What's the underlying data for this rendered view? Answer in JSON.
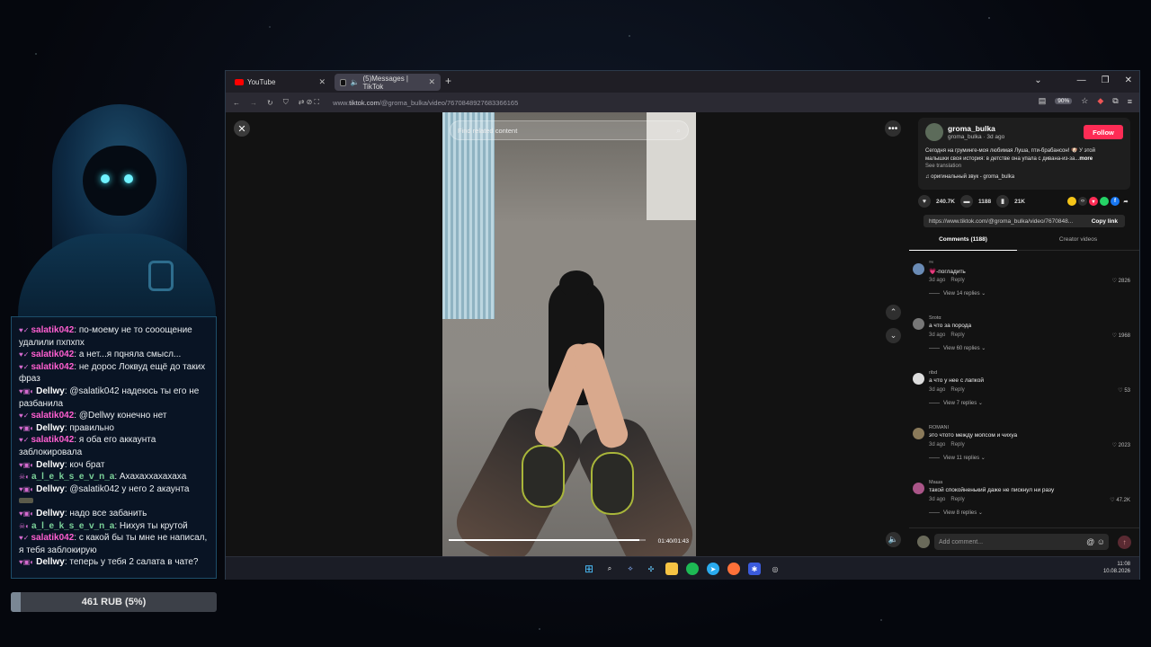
{
  "chat": {
    "messages": [
      {
        "badges": "♥✓",
        "user": "salatik042",
        "color": "pink",
        "text": "по-моему не то сооощение удалили пхпхпх"
      },
      {
        "badges": "♥✓",
        "user": "salatik042",
        "color": "pink",
        "text": "а нет...я пqняла смысл..."
      },
      {
        "badges": "♥✓",
        "user": "salatik042",
        "color": "pink",
        "text": "не дорос Локвуд ещё до таких фраз"
      },
      {
        "badges": "♥▣◐",
        "user": "Dellwy",
        "color": "white",
        "text": "@salatik042 надеюсь ты его не разбанила"
      },
      {
        "badges": "♥✓",
        "user": "salatik042",
        "color": "pink",
        "text": "@Dellwy конечно нет"
      },
      {
        "badges": "♥▣◐",
        "user": "Dellwy",
        "color": "white",
        "text": "правильно"
      },
      {
        "badges": "♥✓",
        "user": "salatik042",
        "color": "pink",
        "text": "я оба его аккаунта заблокировала"
      },
      {
        "badges": "♥▣◐",
        "user": "Dellwy",
        "color": "white",
        "text": "коч брат"
      },
      {
        "badges": "☠◐",
        "user": "a_l_e_k_s_e_v_n_a",
        "color": "green",
        "text": "Ахахаххахахаха"
      },
      {
        "badges": "♥▣◐",
        "user": "Dellwy",
        "color": "white",
        "text": "@salatik042 у него 2 акаунта"
      },
      {
        "badges": "",
        "user": "",
        "color": "white",
        "text": "",
        "sticker": true
      },
      {
        "badges": "♥▣◐",
        "user": "Dellwy",
        "color": "white",
        "text": "надо все забанить"
      },
      {
        "badges": "☠◐",
        "user": "a_l_e_k_s_e_v_n_a",
        "color": "green",
        "text": "Нихуя ты крутой"
      },
      {
        "badges": "♥✓",
        "user": "salatik042",
        "color": "pink",
        "text": "с какой бы ты мне не написал, я тебя заблокирую"
      },
      {
        "badges": "♥▣◐",
        "user": "Dellwy",
        "color": "white",
        "text": "теперь у тебя 2 салата в чате?"
      }
    ]
  },
  "donation": {
    "label": "461 RUB (5%)",
    "progress": 0.05
  },
  "browser": {
    "tabs": [
      {
        "label": "YouTube"
      },
      {
        "label": "(5)Messages | TikTok"
      }
    ],
    "url_prefix": "www.",
    "url_host": "tiktok.com",
    "url_path": "/@groma_bulka/video/7670848927683366165",
    "zoom": "90%"
  },
  "video": {
    "search_placeholder": "Find related content",
    "time": "01:40/01:43",
    "progress": 0.97
  },
  "post": {
    "username": "groma_bulka",
    "meta": "groma_bulka · 3d ago",
    "follow": "Follow",
    "description": "Сегодня на груминге-моя любимая Луша, пти-брабансон! 🐶 У этой малышки своя история: в детстве она упала с дивана-из-за...",
    "more": "more",
    "see_translation": "See translation",
    "sound": "♫ оригинальный звук - groma_bulka",
    "likes": "240.7K",
    "comments": "1188",
    "saves": "21K",
    "link": "https://www.tiktok.com/@groma_bulka/video/7670848...",
    "copy_link": "Copy link",
    "tab_comments": "Comments (1188)",
    "tab_creator": "Creator videos",
    "add_comment": "Add comment..."
  },
  "comments": [
    {
      "user": "ᵐᵉ",
      "text": "💗-погладить",
      "meta": "3d ago",
      "reply": "Reply",
      "likes": "2826",
      "replies": "View 14 replies ⌄"
    },
    {
      "user": "Sτοtα",
      "text": "а что за порода",
      "meta": "3d ago",
      "reply": "Reply",
      "likes": "1968",
      "replies": "View 60 replies ⌄"
    },
    {
      "user": "ribd",
      "text": "а что у нее с лапкой",
      "meta": "3d ago",
      "reply": "Reply",
      "likes": "53",
      "replies": "View 7 replies ⌄"
    },
    {
      "user": "ROMANI",
      "text": "это чтото между мопсом и чихуа",
      "meta": "3d ago",
      "reply": "Reply",
      "likes": "2023",
      "replies": "View 11 replies ⌄"
    },
    {
      "user": "Маша",
      "text": "такой спокойненький даже не пискнул ни разу",
      "meta": "3d ago",
      "reply": "Reply",
      "likes": "47.2K",
      "replies": "View 8 replies ⌄"
    }
  ],
  "taskbar": {
    "time": "11:08",
    "date": "10.08.2026"
  },
  "colors": {
    "accent": "#fe2c55",
    "chat_pink": "#ff5fd1",
    "chat_green": "#7cd39a"
  }
}
